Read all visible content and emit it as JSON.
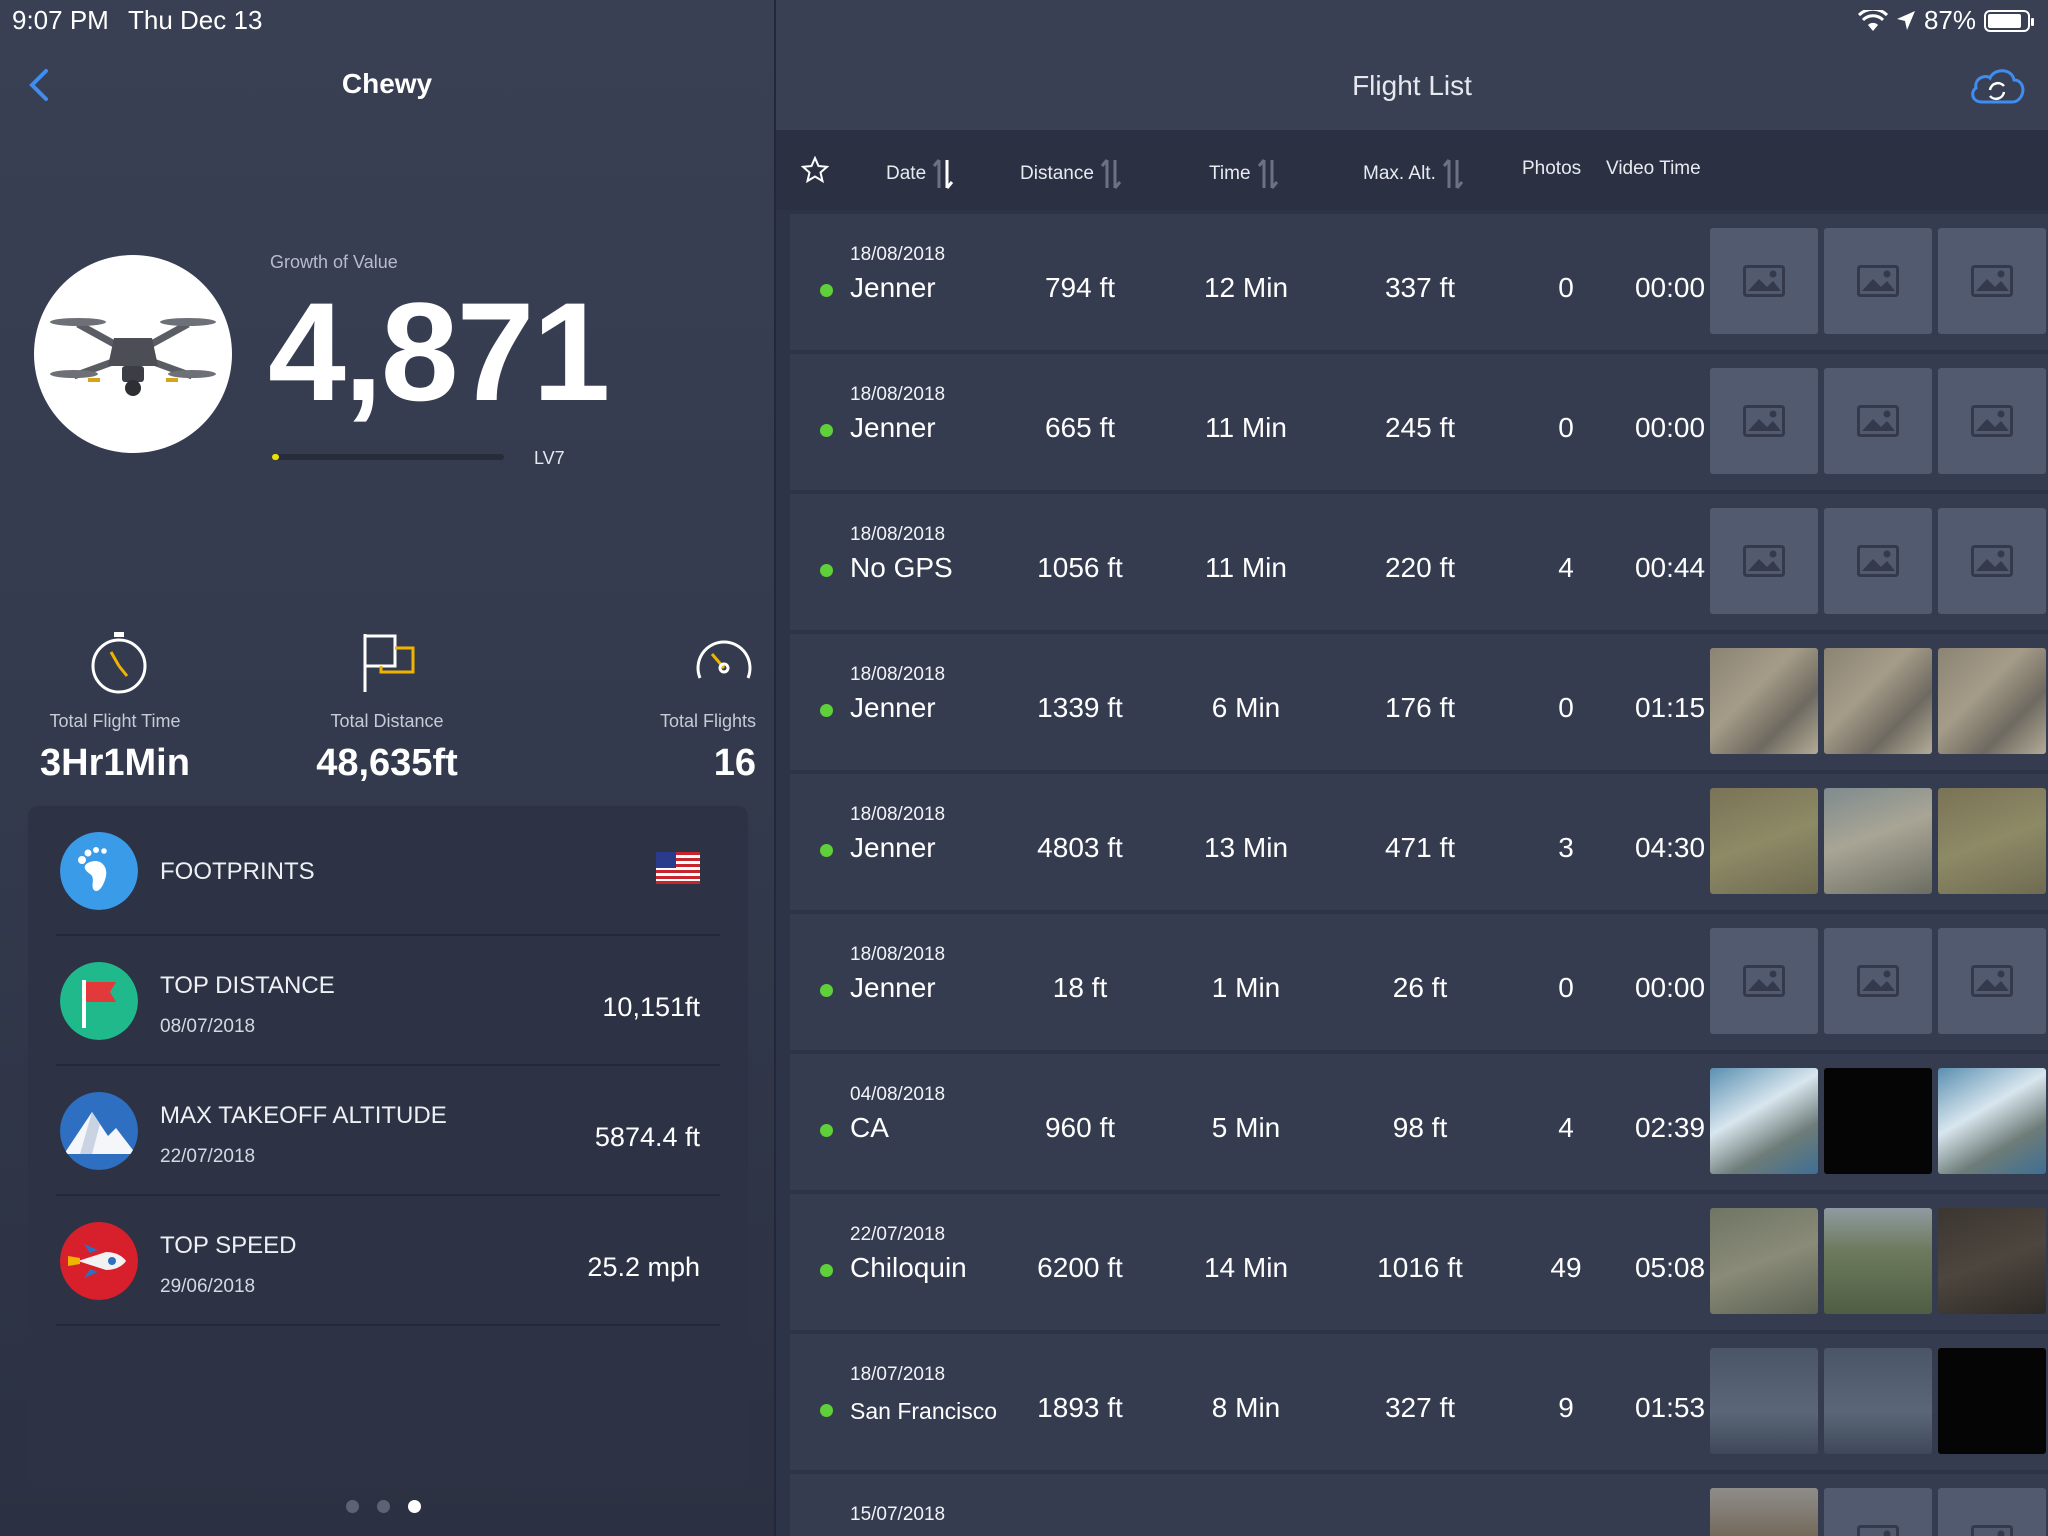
{
  "status_bar": {
    "time": "9:07 PM",
    "date": "Thu Dec 13",
    "battery": "87%",
    "battery_level": 0.87
  },
  "left": {
    "title": "Chewy",
    "growth_label": "Growth of Value",
    "growth_value": "4,871",
    "level": "LV7",
    "level_progress": 0.03,
    "stats": [
      {
        "label": "Total Flight Time",
        "value": "3Hr1Min",
        "icon": "stopwatch-icon"
      },
      {
        "label": "Total Distance",
        "value": "48,635ft",
        "icon": "flag-icon"
      },
      {
        "label": "Total Flights",
        "value": "16",
        "icon": "speedometer-icon"
      }
    ],
    "records": [
      {
        "title": "FOOTPRINTS",
        "icon": "footprint-icon",
        "color": "#3a9be8"
      },
      {
        "title": "TOP DISTANCE",
        "date": "08/07/2018",
        "value": "10,151ft",
        "icon": "red-flag-icon",
        "color": "#1fb98c"
      },
      {
        "title": "MAX TAKEOFF ALTITUDE",
        "date": "22/07/2018",
        "value": "5874.4 ft",
        "icon": "mountain-icon",
        "color": "#2e6fc2"
      },
      {
        "title": "TOP SPEED",
        "date": "29/06/2018",
        "value": "25.2 mph",
        "icon": "rocket-icon",
        "color": "#d8202c"
      }
    ]
  },
  "right": {
    "title": "Flight List",
    "columns": {
      "date": "Date",
      "distance": "Distance",
      "time": "Time",
      "max_alt": "Max. Alt.",
      "photos": "Photos",
      "video": "Video Time"
    },
    "flights": [
      {
        "date": "18/08/2018",
        "location": "Jenner",
        "distance": "794 ft",
        "time": "12 Min",
        "max_alt": "337 ft",
        "photos": "0",
        "video": "00:00",
        "thumbs": [
          "placeholder",
          "placeholder",
          "placeholder"
        ]
      },
      {
        "date": "18/08/2018",
        "location": "Jenner",
        "distance": "665 ft",
        "time": "11 Min",
        "max_alt": "245 ft",
        "photos": "0",
        "video": "00:00",
        "thumbs": [
          "placeholder",
          "placeholder",
          "placeholder"
        ]
      },
      {
        "date": "18/08/2018",
        "location": "No GPS",
        "distance": "1056 ft",
        "time": "11 Min",
        "max_alt": "220 ft",
        "photos": "4",
        "video": "00:44",
        "thumbs": [
          "placeholder",
          "placeholder",
          "placeholder"
        ]
      },
      {
        "date": "18/08/2018",
        "location": "Jenner",
        "distance": "1339 ft",
        "time": "6 Min",
        "max_alt": "176 ft",
        "photos": "0",
        "video": "01:15",
        "thumbs": [
          "rock",
          "rock",
          "rock"
        ]
      },
      {
        "date": "18/08/2018",
        "location": "Jenner",
        "distance": "4803 ft",
        "time": "13 Min",
        "max_alt": "471 ft",
        "photos": "3",
        "video": "04:30",
        "thumbs": [
          "grass",
          "coast",
          "grass"
        ]
      },
      {
        "date": "18/08/2018",
        "location": "Jenner",
        "distance": "18 ft",
        "time": "1 Min",
        "max_alt": "26 ft",
        "photos": "0",
        "video": "00:00",
        "thumbs": [
          "placeholder",
          "placeholder",
          "placeholder"
        ]
      },
      {
        "date": "04/08/2018",
        "location": "CA",
        "distance": "960 ft",
        "time": "5 Min",
        "max_alt": "98 ft",
        "photos": "4",
        "video": "02:39",
        "thumbs": [
          "sea",
          "black",
          "sea"
        ]
      },
      {
        "date": "22/07/2018",
        "location": "Chiloquin",
        "distance": "6200 ft",
        "time": "14 Min",
        "max_alt": "1016 ft",
        "photos": "49",
        "video": "05:08",
        "thumbs": [
          "forest",
          "forest2",
          "dark"
        ]
      },
      {
        "date": "18/07/2018",
        "location": "San Francisco",
        "distance": "1893 ft",
        "time": "8 Min",
        "max_alt": "327 ft",
        "photos": "9",
        "video": "01:53",
        "thumbs": [
          "fog",
          "fog",
          "black"
        ]
      },
      {
        "date": "15/07/2018",
        "location": "",
        "distance": "",
        "time": "",
        "max_alt": "",
        "photos": "",
        "video": "",
        "thumbs": [
          "hill",
          "placeholder",
          "placeholder"
        ]
      }
    ]
  }
}
